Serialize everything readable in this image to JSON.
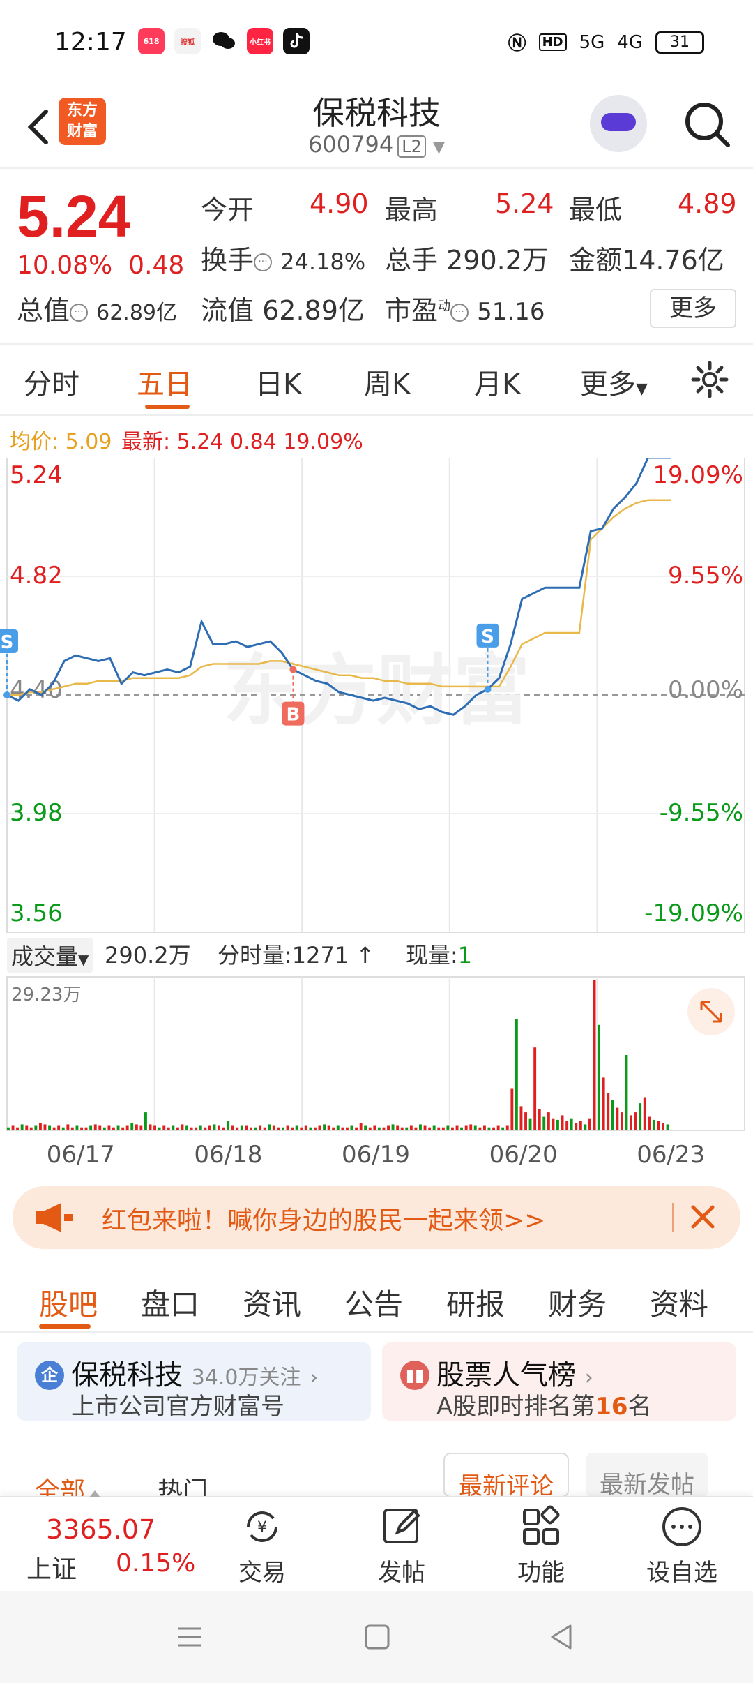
{
  "status_bar": {
    "time": "12:17",
    "apps": [
      {
        "icon": "618-app-icon",
        "color": "#ff3b5c",
        "text": "618"
      },
      {
        "icon": "sohu-video-icon",
        "color": "#f7f7f7",
        "text": "搜狐视频"
      },
      {
        "icon": "wechat-icon",
        "color": "#ffffff",
        "text": ""
      },
      {
        "icon": "xiaohongshu-icon",
        "color": "#ff2442",
        "text": "小红书"
      },
      {
        "icon": "tiktok-icon",
        "color": "#111111",
        "text": ""
      }
    ],
    "network": "5G",
    "network2": "4G",
    "battery": "31"
  },
  "header": {
    "back_icon": "back-arrow-icon",
    "logo_text_line1": "东方",
    "logo_text_line2": "财富",
    "title": "保税科技",
    "code": "600794",
    "level": "L2"
  },
  "quote": {
    "price": "5.24",
    "change_pct": "10.08%",
    "change_amt": "0.48",
    "open_label": "今开",
    "open_value": "4.90",
    "high_label": "最高",
    "high_value": "5.24",
    "low_label": "最低",
    "low_value": "4.89",
    "turnover_label": "换手",
    "turnover_value": "24.18%",
    "volume_label": "总手",
    "volume_value": "290.2万",
    "amount_label": "金额",
    "amount_value": "14.76亿",
    "mktcap_label": "总值",
    "mktcap_value": "62.89亿",
    "float_label": "流值",
    "float_value": "62.89亿",
    "pe_label": "市盈",
    "pe_sup": "动",
    "pe_value": "51.16",
    "more_label": "更多"
  },
  "chart_tabs": {
    "tabs": [
      "分时",
      "五日",
      "日K",
      "周K",
      "月K",
      "更多"
    ],
    "active": "五日"
  },
  "legend": {
    "avg_label": "均价:",
    "avg_value": "5.09",
    "latest_label": "最新:",
    "latest_value": "5.24",
    "latest_change": "0.84",
    "latest_pct": "19.09%"
  },
  "chart_data": {
    "type": "line",
    "x_dates": [
      "06/17",
      "06/18",
      "06/19",
      "06/20",
      "06/23"
    ],
    "y_ticks_left": [
      "5.24",
      "4.82",
      "4.40",
      "3.98",
      "3.56"
    ],
    "y_ticks_right": [
      "19.09%",
      "9.55%",
      "0.00%",
      "-9.55%",
      "-19.09%"
    ],
    "ylim": [
      3.56,
      5.24
    ],
    "base": 4.4,
    "series": [
      {
        "name": "price",
        "color": "#2e6db4",
        "values": [
          4.4,
          4.38,
          4.42,
          4.4,
          4.44,
          4.52,
          4.54,
          4.53,
          4.52,
          4.53,
          4.44,
          4.48,
          4.47,
          4.48,
          4.49,
          4.48,
          4.5,
          4.66,
          4.58,
          4.58,
          4.59,
          4.57,
          4.58,
          4.59,
          4.55,
          4.49,
          4.47,
          4.45,
          4.44,
          4.41,
          4.4,
          4.39,
          4.38,
          4.39,
          4.38,
          4.37,
          4.35,
          4.36,
          4.34,
          4.33,
          4.36,
          4.4,
          4.42,
          4.46,
          4.58,
          4.74,
          4.76,
          4.78,
          4.78,
          4.78,
          4.78,
          4.98,
          4.99,
          5.06,
          5.1,
          5.15,
          5.24,
          5.24,
          5.24
        ]
      },
      {
        "name": "avg",
        "color": "#e8b84a",
        "values": [
          4.4,
          4.4,
          4.41,
          4.41,
          4.42,
          4.43,
          4.44,
          4.44,
          4.45,
          4.45,
          4.45,
          4.46,
          4.46,
          4.46,
          4.46,
          4.46,
          4.47,
          4.5,
          4.51,
          4.51,
          4.51,
          4.51,
          4.51,
          4.52,
          4.52,
          4.51,
          4.5,
          4.49,
          4.48,
          4.47,
          4.47,
          4.46,
          4.46,
          4.45,
          4.45,
          4.44,
          4.44,
          4.44,
          4.43,
          4.43,
          4.43,
          4.43,
          4.43,
          4.43,
          4.5,
          4.58,
          4.6,
          4.62,
          4.62,
          4.62,
          4.62,
          4.95,
          4.99,
          5.03,
          5.06,
          5.08,
          5.09,
          5.09,
          5.09
        ]
      }
    ],
    "markers": [
      {
        "label": "S",
        "index": 0,
        "color": "#4a9ee8"
      },
      {
        "label": "B",
        "index": 25,
        "color": "#ef6b5e"
      },
      {
        "label": "S",
        "index": 42,
        "color": "#4a9ee8"
      }
    ],
    "grid": true,
    "watermark": "东方财富"
  },
  "volume": {
    "label": "成交量",
    "total": "290.2万",
    "tick_label": "分时量:1271",
    "now_label": "现量:",
    "now_value": "1",
    "max_label": "29.23万",
    "bars": [
      2,
      3,
      2,
      4,
      3,
      2,
      3,
      5,
      4,
      3,
      2,
      3,
      2,
      4,
      2,
      3,
      2,
      2,
      3,
      4,
      3,
      2,
      3,
      2,
      3,
      2,
      3,
      5,
      4,
      3,
      12,
      4,
      3,
      2,
      3,
      2,
      3,
      2,
      4,
      3,
      2,
      2,
      3,
      2,
      3,
      4,
      3,
      2,
      6,
      3,
      2,
      3,
      3,
      2,
      2,
      3,
      2,
      4,
      3,
      2,
      2,
      3,
      2,
      3,
      2,
      3,
      2,
      2,
      3,
      4,
      3,
      2,
      3,
      2,
      2,
      3,
      2,
      5,
      3,
      2,
      3,
      2,
      2,
      3,
      4,
      3,
      2,
      2,
      3,
      2,
      4,
      3,
      2,
      3,
      2,
      2,
      3,
      2,
      3,
      2,
      3,
      4,
      3,
      2,
      3,
      2,
      2,
      3,
      2,
      3,
      28,
      74,
      16,
      12,
      8,
      55,
      14,
      9,
      12,
      8,
      7,
      10,
      6,
      8,
      5,
      6,
      4,
      8,
      100,
      70,
      35,
      25,
      20,
      15,
      12,
      50,
      10,
      12,
      18,
      22,
      9,
      7,
      6,
      5,
      4
    ]
  },
  "banner": {
    "text": "红包来啦！喊你身边的股民一起来领>>",
    "icon": "megaphone-icon"
  },
  "sub_tabs": {
    "tabs": [
      "股吧",
      "盘口",
      "资讯",
      "公告",
      "研报",
      "财务",
      "资料"
    ],
    "active": "股吧"
  },
  "cards": [
    {
      "icon_text": "企",
      "title": "保税科技",
      "extra": "34.0万关注",
      "sub": "上市公司官方财富号"
    },
    {
      "icon_text": "",
      "title": "股票人气榜",
      "sub_prefix": "A股即时排名第",
      "rank": "16",
      "sub_suffix": "名"
    }
  ],
  "partial_tabs": [
    "全部",
    "热门",
    "最新评论",
    "最新发帖"
  ],
  "bottom_nav": {
    "index_value": "3365.07",
    "index_name": "上证",
    "index_change": "0.15%",
    "items": [
      {
        "label": "交易",
        "icon": "trade-icon"
      },
      {
        "label": "发帖",
        "icon": "post-icon"
      },
      {
        "label": "功能",
        "icon": "apps-icon"
      },
      {
        "label": "设自选",
        "icon": "more-circle-icon"
      }
    ]
  }
}
